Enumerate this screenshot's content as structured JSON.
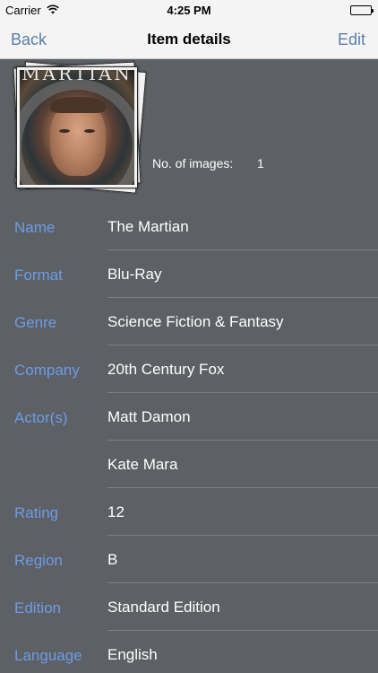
{
  "status_bar": {
    "carrier": "Carrier",
    "time": "4:25 PM"
  },
  "nav": {
    "back": "Back",
    "title": "Item details",
    "edit": "Edit"
  },
  "poster": {
    "title": "MARTIAN"
  },
  "images": {
    "label": "No. of images:",
    "count": "1"
  },
  "details": [
    {
      "label": "Name",
      "value": "The Martian"
    },
    {
      "label": "Format",
      "value": "Blu-Ray"
    },
    {
      "label": "Genre",
      "value": "Science Fiction & Fantasy"
    },
    {
      "label": "Company",
      "value": "20th Century Fox"
    },
    {
      "label": "Actor(s)",
      "value": "Matt Damon"
    },
    {
      "label": "",
      "value": "Kate Mara"
    },
    {
      "label": "Rating",
      "value": "12"
    },
    {
      "label": "Region",
      "value": "B"
    },
    {
      "label": "Edition",
      "value": "Standard Edition"
    },
    {
      "label": "Language",
      "value": "English"
    }
  ],
  "colors": {
    "label": "#6d9ce6",
    "background": "#5d6064",
    "nav_tint": "#5b7ea8"
  }
}
